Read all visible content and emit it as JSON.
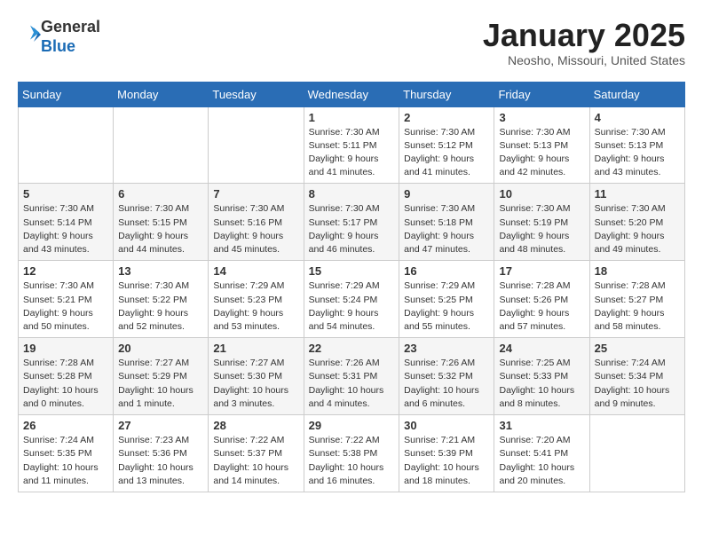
{
  "logo": {
    "general": "General",
    "blue": "Blue"
  },
  "title": "January 2025",
  "location": "Neosho, Missouri, United States",
  "days_of_week": [
    "Sunday",
    "Monday",
    "Tuesday",
    "Wednesday",
    "Thursday",
    "Friday",
    "Saturday"
  ],
  "weeks": [
    [
      {
        "day": "",
        "info": ""
      },
      {
        "day": "",
        "info": ""
      },
      {
        "day": "",
        "info": ""
      },
      {
        "day": "1",
        "info": "Sunrise: 7:30 AM\nSunset: 5:11 PM\nDaylight: 9 hours\nand 41 minutes."
      },
      {
        "day": "2",
        "info": "Sunrise: 7:30 AM\nSunset: 5:12 PM\nDaylight: 9 hours\nand 41 minutes."
      },
      {
        "day": "3",
        "info": "Sunrise: 7:30 AM\nSunset: 5:13 PM\nDaylight: 9 hours\nand 42 minutes."
      },
      {
        "day": "4",
        "info": "Sunrise: 7:30 AM\nSunset: 5:13 PM\nDaylight: 9 hours\nand 43 minutes."
      }
    ],
    [
      {
        "day": "5",
        "info": "Sunrise: 7:30 AM\nSunset: 5:14 PM\nDaylight: 9 hours\nand 43 minutes."
      },
      {
        "day": "6",
        "info": "Sunrise: 7:30 AM\nSunset: 5:15 PM\nDaylight: 9 hours\nand 44 minutes."
      },
      {
        "day": "7",
        "info": "Sunrise: 7:30 AM\nSunset: 5:16 PM\nDaylight: 9 hours\nand 45 minutes."
      },
      {
        "day": "8",
        "info": "Sunrise: 7:30 AM\nSunset: 5:17 PM\nDaylight: 9 hours\nand 46 minutes."
      },
      {
        "day": "9",
        "info": "Sunrise: 7:30 AM\nSunset: 5:18 PM\nDaylight: 9 hours\nand 47 minutes."
      },
      {
        "day": "10",
        "info": "Sunrise: 7:30 AM\nSunset: 5:19 PM\nDaylight: 9 hours\nand 48 minutes."
      },
      {
        "day": "11",
        "info": "Sunrise: 7:30 AM\nSunset: 5:20 PM\nDaylight: 9 hours\nand 49 minutes."
      }
    ],
    [
      {
        "day": "12",
        "info": "Sunrise: 7:30 AM\nSunset: 5:21 PM\nDaylight: 9 hours\nand 50 minutes."
      },
      {
        "day": "13",
        "info": "Sunrise: 7:30 AM\nSunset: 5:22 PM\nDaylight: 9 hours\nand 52 minutes."
      },
      {
        "day": "14",
        "info": "Sunrise: 7:29 AM\nSunset: 5:23 PM\nDaylight: 9 hours\nand 53 minutes."
      },
      {
        "day": "15",
        "info": "Sunrise: 7:29 AM\nSunset: 5:24 PM\nDaylight: 9 hours\nand 54 minutes."
      },
      {
        "day": "16",
        "info": "Sunrise: 7:29 AM\nSunset: 5:25 PM\nDaylight: 9 hours\nand 55 minutes."
      },
      {
        "day": "17",
        "info": "Sunrise: 7:28 AM\nSunset: 5:26 PM\nDaylight: 9 hours\nand 57 minutes."
      },
      {
        "day": "18",
        "info": "Sunrise: 7:28 AM\nSunset: 5:27 PM\nDaylight: 9 hours\nand 58 minutes."
      }
    ],
    [
      {
        "day": "19",
        "info": "Sunrise: 7:28 AM\nSunset: 5:28 PM\nDaylight: 10 hours\nand 0 minutes."
      },
      {
        "day": "20",
        "info": "Sunrise: 7:27 AM\nSunset: 5:29 PM\nDaylight: 10 hours\nand 1 minute."
      },
      {
        "day": "21",
        "info": "Sunrise: 7:27 AM\nSunset: 5:30 PM\nDaylight: 10 hours\nand 3 minutes."
      },
      {
        "day": "22",
        "info": "Sunrise: 7:26 AM\nSunset: 5:31 PM\nDaylight: 10 hours\nand 4 minutes."
      },
      {
        "day": "23",
        "info": "Sunrise: 7:26 AM\nSunset: 5:32 PM\nDaylight: 10 hours\nand 6 minutes."
      },
      {
        "day": "24",
        "info": "Sunrise: 7:25 AM\nSunset: 5:33 PM\nDaylight: 10 hours\nand 8 minutes."
      },
      {
        "day": "25",
        "info": "Sunrise: 7:24 AM\nSunset: 5:34 PM\nDaylight: 10 hours\nand 9 minutes."
      }
    ],
    [
      {
        "day": "26",
        "info": "Sunrise: 7:24 AM\nSunset: 5:35 PM\nDaylight: 10 hours\nand 11 minutes."
      },
      {
        "day": "27",
        "info": "Sunrise: 7:23 AM\nSunset: 5:36 PM\nDaylight: 10 hours\nand 13 minutes."
      },
      {
        "day": "28",
        "info": "Sunrise: 7:22 AM\nSunset: 5:37 PM\nDaylight: 10 hours\nand 14 minutes."
      },
      {
        "day": "29",
        "info": "Sunrise: 7:22 AM\nSunset: 5:38 PM\nDaylight: 10 hours\nand 16 minutes."
      },
      {
        "day": "30",
        "info": "Sunrise: 7:21 AM\nSunset: 5:39 PM\nDaylight: 10 hours\nand 18 minutes."
      },
      {
        "day": "31",
        "info": "Sunrise: 7:20 AM\nSunset: 5:41 PM\nDaylight: 10 hours\nand 20 minutes."
      },
      {
        "day": "",
        "info": ""
      }
    ]
  ]
}
